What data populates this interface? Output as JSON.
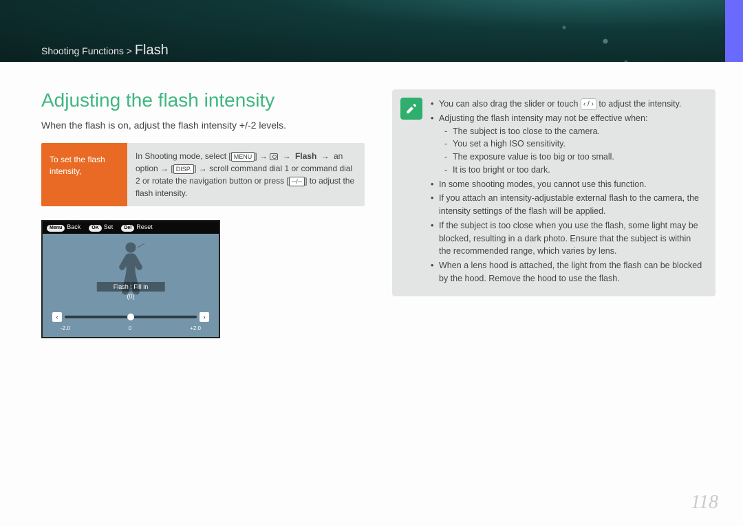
{
  "breadcrumb": {
    "section": "Shooting Functions",
    "separator": ">",
    "page": "Flash"
  },
  "title": "Adjusting the flash intensity",
  "intro": "When the flash is on, adjust the flash intensity +/-2 levels.",
  "instruction": {
    "label": "To set the flash intensity,",
    "menu_btn": "MENU",
    "flash_word": "Flash",
    "an_option": "an option",
    "disp_btn": "DISP.",
    "body_pre": "In Shooting mode, select [",
    "body_mid1": "] → ",
    "body_mid2": " → ",
    "body_mid3": " → ",
    "body_line2a": " → [",
    "body_line2b": "] → scroll command dial 1 or command dial 2 or rotate the navigation button or press [",
    "minus_plus": "─/─",
    "body_line2c": "] to adjust the flash intensity."
  },
  "preview": {
    "back_btn": "Menu",
    "back_lbl": "Back",
    "set_btn": "OK",
    "set_lbl": "Set",
    "reset_btn": "Del",
    "reset_lbl": "Reset",
    "flash_mode": "Flash : Fill in",
    "flash_value": "(0)",
    "left_arrow": "‹",
    "right_arrow": "›",
    "tick_min": "-2.0",
    "tick_mid": "0",
    "tick_max": "+2.0"
  },
  "info": {
    "bullets": [
      "You can also drag the slider or touch __NAV__ to adjust the intensity.",
      "Adjusting the flash intensity may not be effective when:",
      "In some shooting modes, you cannot use this function.",
      "If you attach an intensity-adjustable external flash to the camera, the intensity settings of the flash will be applied.",
      "If the subject is too close when you use the flash, some light may be blocked, resulting in a dark photo. Ensure that the subject is within the recommended range, which varies by lens.",
      "When a lens hood is attached, the light from the flash can be blocked by the hood. Remove the hood to use the flash."
    ],
    "sub_bullets": [
      "The subject is too close to the camera.",
      "You set a high ISO sensitivity.",
      "The exposure value is too big or too small.",
      "It is too bright or too dark."
    ],
    "nav_left": "‹",
    "nav_sep": "/",
    "nav_right": "›"
  },
  "page_number": "118"
}
